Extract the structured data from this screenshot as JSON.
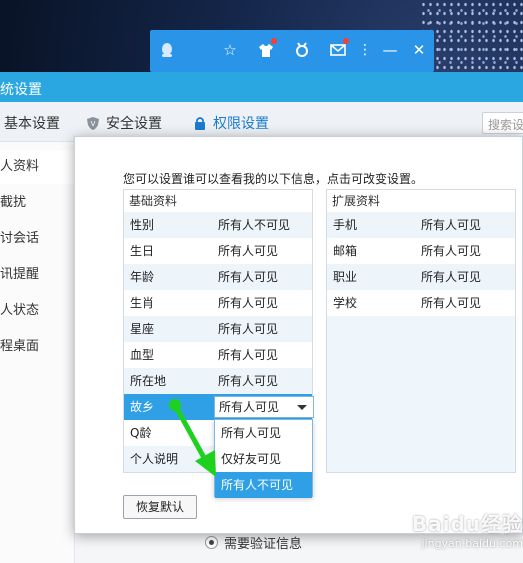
{
  "window_title": "统设置",
  "tabs": [
    {
      "label": "基本设置"
    },
    {
      "label": "安全设置"
    },
    {
      "label": "权限设置"
    }
  ],
  "search_placeholder": "搜索设",
  "sidebar": [
    "人资料",
    "截扰",
    "讨会话",
    "讯提醒",
    "人状态",
    "程桌面"
  ],
  "bottom_radio_label": "需要验证信息",
  "dialog": {
    "description": "您可以设置谁可以查看我的以下信息，点击可改变设置。",
    "basic_header": "基础资料",
    "basic_rows": [
      {
        "key": "性别",
        "value": "所有人不可见"
      },
      {
        "key": "生日",
        "value": "所有人可见"
      },
      {
        "key": "年龄",
        "value": "所有人可见"
      },
      {
        "key": "生肖",
        "value": "所有人可见"
      },
      {
        "key": "星座",
        "value": "所有人可见"
      },
      {
        "key": "血型",
        "value": "所有人可见"
      },
      {
        "key": "所在地",
        "value": "所有人可见"
      },
      {
        "key": "故乡",
        "value": "所有人可见"
      },
      {
        "key": "Q龄",
        "value": ""
      },
      {
        "key": "个人说明",
        "value": ""
      }
    ],
    "ext_header": "扩展资料",
    "ext_rows": [
      {
        "key": "手机",
        "value": "所有人可见"
      },
      {
        "key": "邮箱",
        "value": "所有人可见"
      },
      {
        "key": "职业",
        "value": "所有人可见"
      },
      {
        "key": "学校",
        "value": "所有人可见"
      }
    ],
    "dropdown_options": [
      "所有人可见",
      "仅好友可见",
      "所有人不可见"
    ],
    "restore_button": "恢复默认"
  },
  "watermark": {
    "logo": "Baidu经验",
    "url": "jingyan.baidu.com"
  },
  "colors": {
    "titlebar": "#2aa7e0",
    "selected_row": "#2fa0e6",
    "arrow": "#1fd11f"
  }
}
